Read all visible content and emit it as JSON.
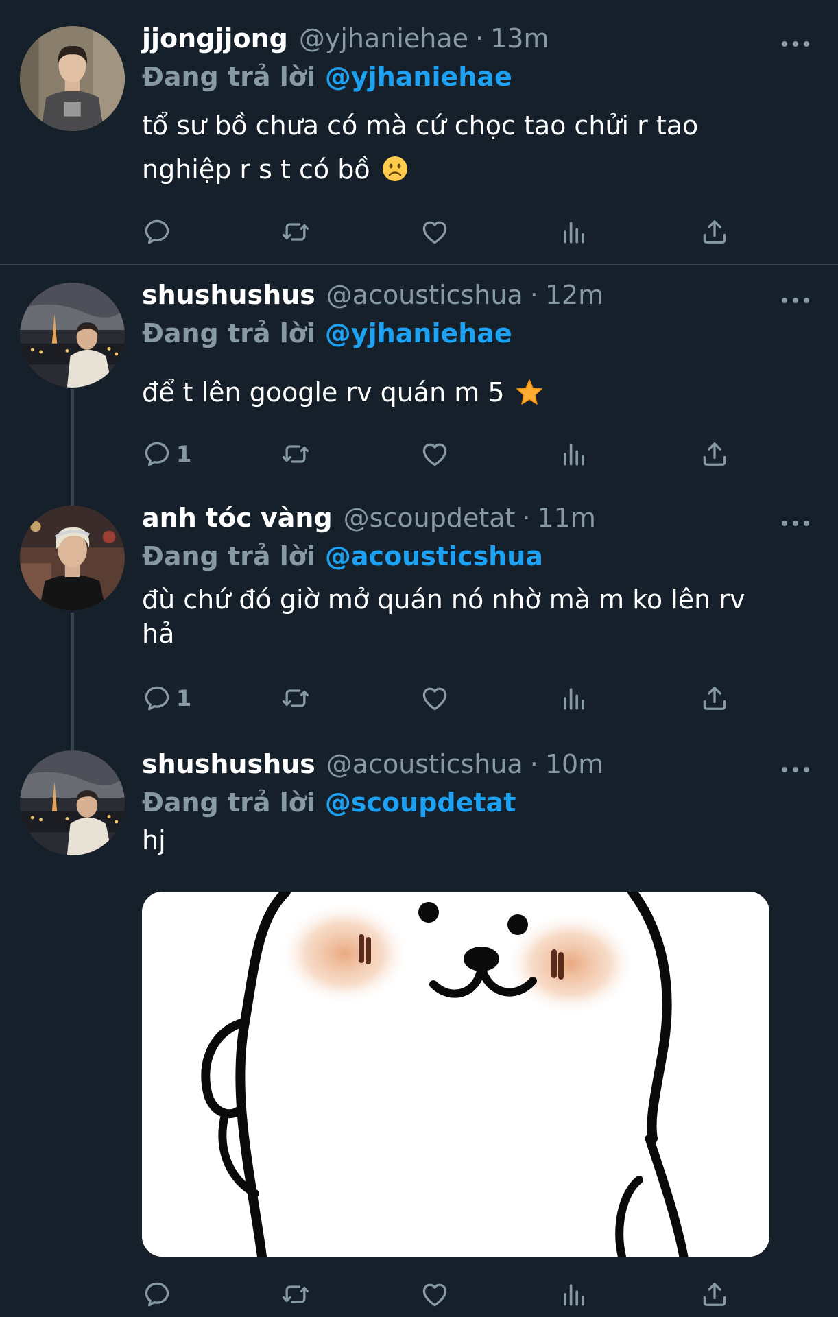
{
  "tweets": [
    {
      "name": "jjongjjong",
      "handle": "@yjhaniehae",
      "separator": "·",
      "time": "13m",
      "reply_prefix": "Đang trả lời",
      "reply_to": "@yjhaniehae",
      "text": "tổ sư bồ chưa có mà cứ chọc tao chửi r tao nghiệp r s t có bồ",
      "emoji": "slightly-frowning-face",
      "reply_count": ""
    },
    {
      "name": "shushushus",
      "handle": "@acousticshua",
      "separator": "·",
      "time": "12m",
      "reply_prefix": "Đang trả lời",
      "reply_to": "@yjhaniehae",
      "text": "để t lên google rv quán m 5",
      "emoji": "star",
      "reply_count": "1"
    },
    {
      "name": "anh tóc vàng",
      "handle": "@scoupdetat",
      "separator": "·",
      "time": "11m",
      "reply_prefix": "Đang trả lời",
      "reply_to": "@acousticshua",
      "text": "đù chứ đó giờ mở quán nó nhờ mà m ko lên rv hả",
      "reply_count": "1"
    },
    {
      "name": "shushushus",
      "handle": "@acousticshua",
      "separator": "·",
      "time": "10m",
      "reply_prefix": "Đang trả lời",
      "reply_to": "@scoupdetat",
      "text": "hj",
      "media": "white-seal-cartoon-sticker",
      "reply_count": ""
    }
  ],
  "colors": {
    "background": "#15202b",
    "secondary_text": "#8899a6",
    "link": "#1da1f2",
    "divider": "#38444d"
  },
  "icons": [
    "reply-icon",
    "retweet-icon",
    "like-icon",
    "analytics-icon",
    "share-icon",
    "more-icon"
  ]
}
